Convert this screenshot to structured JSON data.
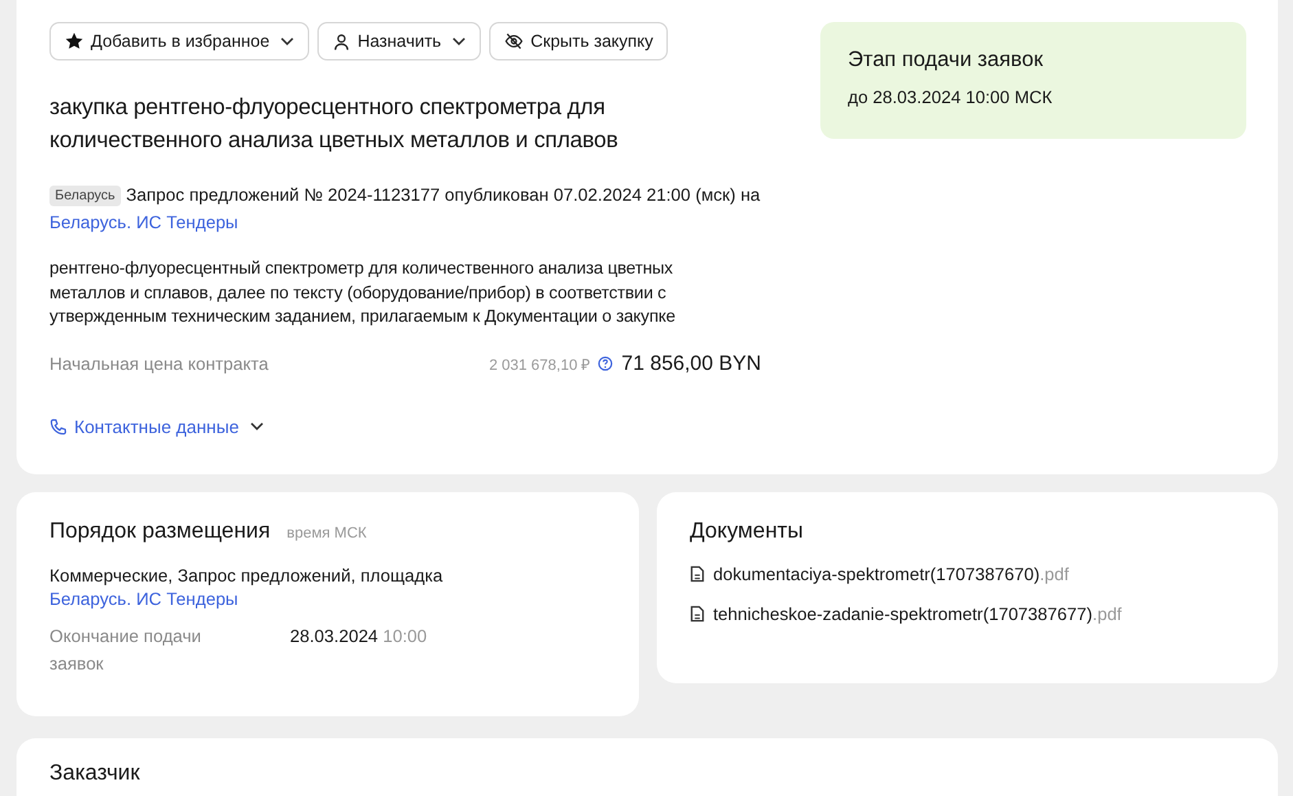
{
  "actions": [
    {
      "kind": "favorite",
      "label": "Добавить в избранное",
      "dropdown": true
    },
    {
      "kind": "assign",
      "label": "Назначить",
      "dropdown": true
    },
    {
      "kind": "hide",
      "label": "Скрыть закупку",
      "dropdown": false
    }
  ],
  "title": "закупка рентгено-флуоресцентного спектрометра для количественного анализа цветных металлов и сплавов",
  "region_badge": "Беларусь",
  "notice": {
    "text": "Запрос предложений № 2024-1123177 опубликован 07.02.2024 21:00 (мск) на ",
    "link": "Беларусь. ИС Тендеры"
  },
  "description": "рентгено-флуоресцентный спектрометр для количественного анализа цветных металлов и сплавов, далее по тексту (оборудование/прибор) в соответствии с утвержденным техническим заданием, прилагаемым к Документации о закупке",
  "price": {
    "label": "Начальная цена контракта",
    "converted": "2 031 678,10 ₽",
    "value": "71 856,00 BYN"
  },
  "contacts_link": "Контактные данные",
  "stage": {
    "title": "Этап подачи заявок",
    "deadline": "до 28.03.2024 10:00 МСК"
  },
  "placement": {
    "title": "Порядок размещения",
    "note": "время МСК",
    "text": "Коммерческие, Запрос предложений, площадка",
    "link": "Беларусь. ИС Тендеры",
    "deadline_label": "Окончание подачи заявок",
    "deadline_date": "28.03.2024",
    "deadline_time": "10:00"
  },
  "documents": {
    "title": "Документы",
    "files": [
      {
        "name": "dokumentaciya-spektrometr(1707387670)",
        "ext": ".pdf"
      },
      {
        "name": "tehnicheskoe-zadanie-spektrometr(1707387677)",
        "ext": ".pdf"
      }
    ]
  },
  "customer": {
    "title": "Заказчик"
  }
}
